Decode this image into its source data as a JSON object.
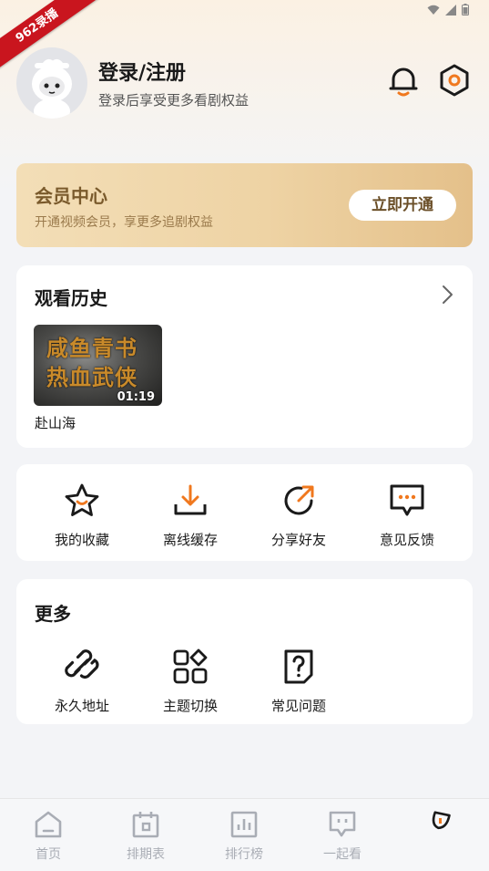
{
  "watermark": "962录播",
  "header": {
    "login_title": "登录/注册",
    "login_subtitle": "登录后享受更多看剧权益"
  },
  "vip": {
    "title": "会员中心",
    "subtitle": "开通视频会员，享更多追剧权益",
    "button": "立即开通"
  },
  "history": {
    "title": "观看历史",
    "items": [
      {
        "name": "赴山海",
        "thumb_title_line1": "咸鱼青书",
        "thumb_title_line2": "热血武侠",
        "duration": "01:19"
      }
    ]
  },
  "actions": [
    {
      "label": "我的收藏",
      "icon": "star-icon"
    },
    {
      "label": "离线缓存",
      "icon": "download-icon"
    },
    {
      "label": "分享好友",
      "icon": "share-icon"
    },
    {
      "label": "意见反馈",
      "icon": "feedback-icon"
    }
  ],
  "more": {
    "title": "更多",
    "items": [
      {
        "label": "永久地址",
        "icon": "link-icon"
      },
      {
        "label": "主题切换",
        "icon": "theme-icon"
      },
      {
        "label": "常见问题",
        "icon": "faq-icon"
      }
    ]
  },
  "tabs": [
    {
      "label": "首页",
      "icon": "home-icon"
    },
    {
      "label": "排期表",
      "icon": "calendar-icon"
    },
    {
      "label": "排行榜",
      "icon": "ranking-icon"
    },
    {
      "label": "一起看",
      "icon": "chat-icon"
    },
    {
      "label": "",
      "icon": "profile-icon",
      "active": true
    }
  ],
  "colors": {
    "accent": "#f0781e",
    "vip_gold": "#e4c08a",
    "tab_inactive": "#a9adb5"
  }
}
